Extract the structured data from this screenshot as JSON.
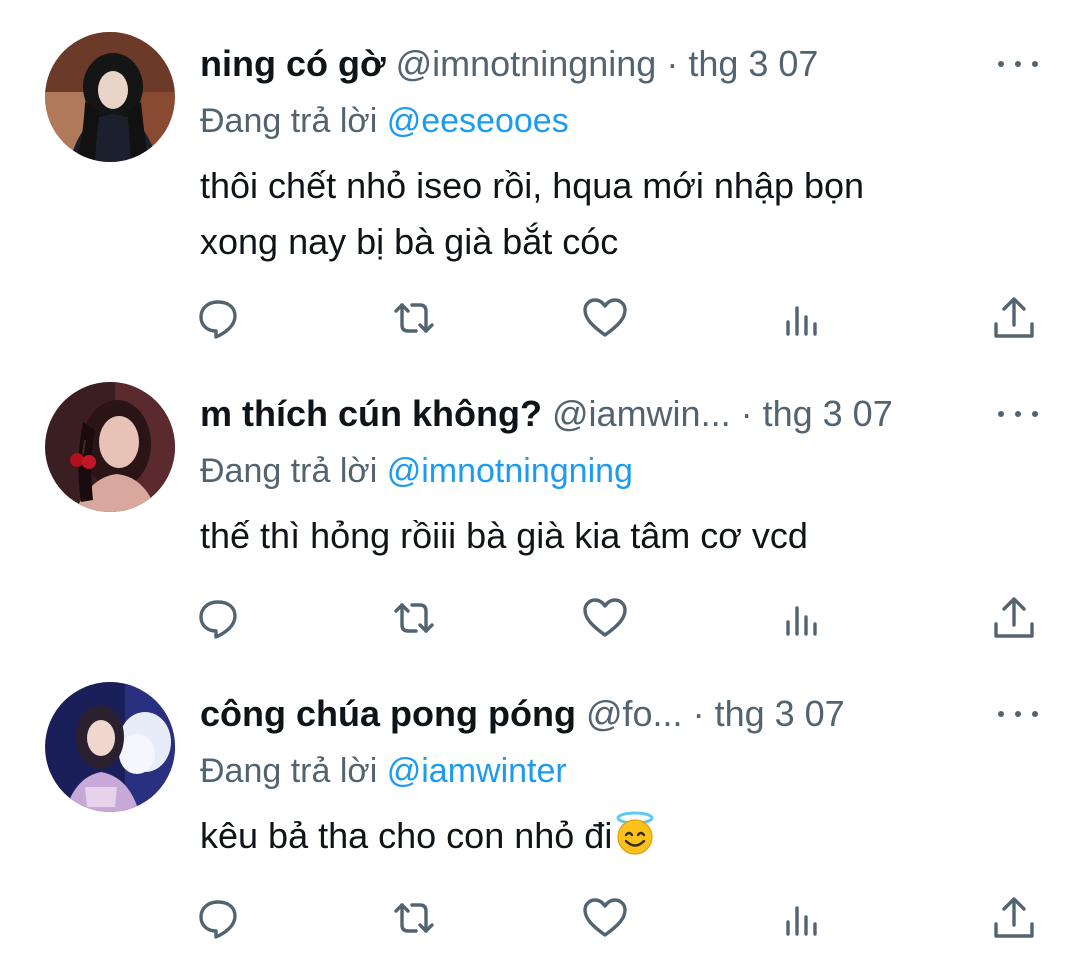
{
  "tweets": [
    {
      "name": "ning có gờ",
      "handle": "@imnotningning",
      "separator": "·",
      "time": "thg 3 07",
      "reply_prefix": "Đang trả lời",
      "reply_to": "@eeseooes",
      "text_lines": [
        "thôi chết nhỏ iseo rồi, hqua mới nhập bọn",
        "xong nay bị bà già bắt cóc"
      ]
    },
    {
      "name": "m thích cún không?",
      "handle": "@iamwin...",
      "separator": "·",
      "time": "thg 3 07",
      "reply_prefix": "Đang trả lời",
      "reply_to": "@imnotningning",
      "text_lines": [
        "thế thì hỏng rồiii bà già kia tâm cơ vcd"
      ]
    },
    {
      "name": "công chúa pong póng",
      "handle": "@fo...",
      "separator": "·",
      "time": "thg 3 07",
      "reply_prefix": "Đang trả lời",
      "reply_to": "@iamwinter",
      "text_lines": [
        "kêu bả tha cho con nhỏ đi"
      ],
      "emoji": "smiling-face-with-halo"
    }
  ],
  "colors": {
    "text_primary": "#0f1419",
    "text_secondary": "#536471",
    "mention": "#1d9bf0"
  },
  "icons": [
    "reply-icon",
    "retweet-icon",
    "like-icon",
    "views-icon",
    "share-icon",
    "more-icon"
  ]
}
